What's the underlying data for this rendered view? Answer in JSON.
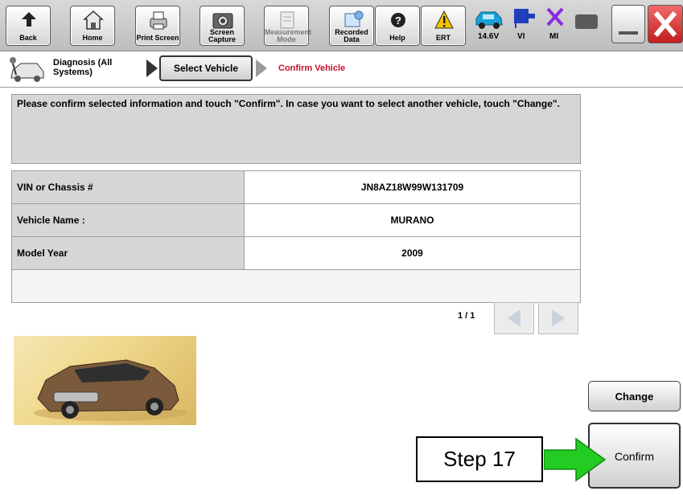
{
  "toolbar": {
    "buttons": [
      {
        "label": "Back",
        "icon": "back-arrow-icon"
      },
      {
        "label": "Home",
        "icon": "home-icon"
      },
      {
        "label": "Print Screen",
        "icon": "printer-icon"
      },
      {
        "label": "Screen Capture",
        "icon": "camera-icon"
      },
      {
        "label": "Measurement Mode",
        "icon": "measurement-icon",
        "disabled": true
      },
      {
        "label": "Recorded Data",
        "icon": "recorded-data-icon"
      },
      {
        "label": "Help",
        "icon": "help-icon"
      },
      {
        "label": "ERT",
        "icon": "warning-icon"
      }
    ],
    "status": {
      "battery_voltage": "14.6V",
      "vi_label": "VI",
      "mi_label": "MI"
    }
  },
  "breadcrumb": {
    "home": "Diagnosis (All Systems)",
    "step": "Select Vehicle",
    "current": "Confirm Vehicle"
  },
  "message": "Please confirm selected information and touch \"Confirm\". In case you want to select another vehicle, touch \"Change\".",
  "vehicle_info": {
    "rows": [
      {
        "label": "VIN or Chassis #",
        "value": "JN8AZ18W99W131709"
      },
      {
        "label": "Vehicle Name :",
        "value": "MURANO"
      },
      {
        "label": "Model Year",
        "value": "2009"
      }
    ]
  },
  "pager": "1 / 1",
  "actions": {
    "change": "Change",
    "confirm": "Confirm"
  },
  "annotation": {
    "step_label": "Step 17"
  },
  "colors": {
    "breadcrumb_current": "#c8102e",
    "close_button": "#e33b3b",
    "annotation_arrow": "#22cc22",
    "mi_icon": "#8a2be2",
    "vi_icon": "#1f3fbf"
  }
}
